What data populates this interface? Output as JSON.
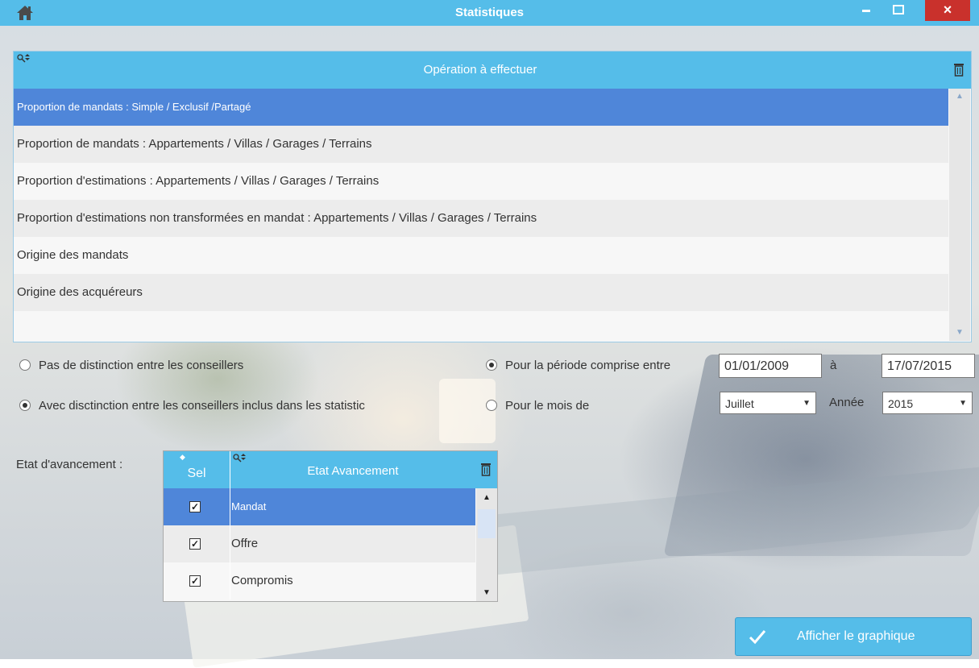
{
  "window": {
    "title": "Statistiques",
    "icons": [
      "home-icon",
      "minimize-icon",
      "maximize-icon",
      "close-icon"
    ],
    "close_glyph": "×"
  },
  "operations": {
    "header": "Opération à effectuer",
    "rows": [
      "Proportion de mandats : Simple / Exclusif /Partagé",
      "Proportion de mandats : Appartements / Villas / Garages / Terrains",
      "Proportion d'estimations : Appartements / Villas / Garages / Terrains",
      "Proportion d'estimations non transformées en mandat : Appartements / Villas / Garages / Terrains",
      "Origine des mandats",
      "Origine des acquéreurs"
    ],
    "selected_index": 0
  },
  "options": {
    "no_distinction_label": "Pas de distinction entre les conseillers",
    "with_distinction_label": "Avec disctinction entre les conseillers inclus dans les statistic",
    "period_label": "Pour la période comprise entre",
    "date_from": "01/01/2009",
    "date_sep": "à",
    "date_to": "17/07/2015",
    "month_label": "Pour le mois de",
    "month_value": "Juillet",
    "year_label": "Année",
    "year_value": "2015",
    "distinction_selected": "with",
    "period_selected": "range"
  },
  "etat": {
    "label": "Etat d'avancement :",
    "col_sel": "Sel",
    "col_etat": "Etat Avancement",
    "rows": [
      {
        "label": "Mandat",
        "checked": true
      },
      {
        "label": "Offre",
        "checked": true
      },
      {
        "label": "Compromis",
        "checked": true
      }
    ]
  },
  "action": {
    "graph_button": "Afficher le graphique"
  },
  "colors": {
    "accent": "#55bde9",
    "selection": "#4f86d9",
    "close": "#c9312c"
  }
}
